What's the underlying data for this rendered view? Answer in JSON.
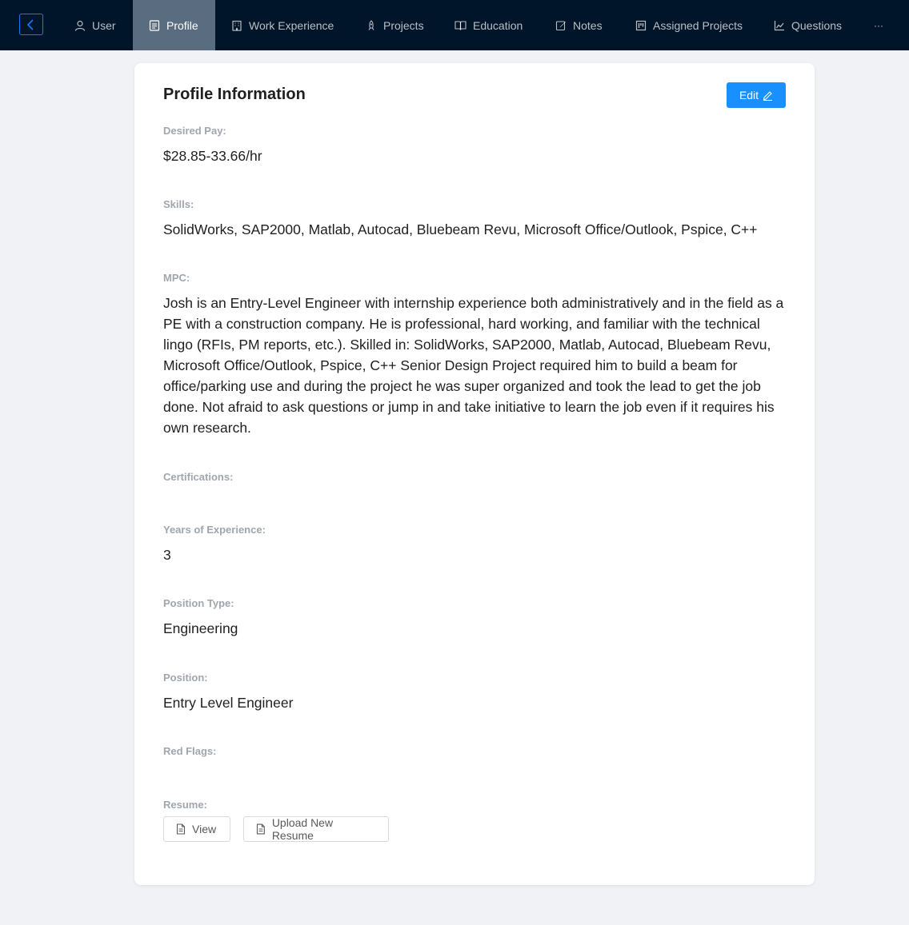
{
  "nav": {
    "back_icon": "chevron-left-icon",
    "items": [
      {
        "label": "User",
        "icon": "user-icon"
      },
      {
        "label": "Profile",
        "icon": "profile-icon",
        "active": true
      },
      {
        "label": "Work Experience",
        "icon": "building-icon"
      },
      {
        "label": "Projects",
        "icon": "rocket-icon"
      },
      {
        "label": "Education",
        "icon": "book-icon"
      },
      {
        "label": "Notes",
        "icon": "edit-icon"
      },
      {
        "label": "Assigned Projects",
        "icon": "project-icon"
      },
      {
        "label": "Questions",
        "icon": "chart-icon"
      }
    ],
    "more_label": "···"
  },
  "card": {
    "title": "Profile Information",
    "edit_label": "Edit"
  },
  "fields": {
    "desired_pay": {
      "label": "Desired Pay:",
      "value": "$28.85-33.66/hr"
    },
    "skills": {
      "label": "Skills:",
      "value": "SolidWorks, SAP2000, Matlab, Autocad, Bluebeam Revu, Microsoft Office/Outlook, Pspice, C++"
    },
    "mpc": {
      "label": "MPC:",
      "value": "Josh is an Entry-Level Engineer with internship experience both administratively and in the field as a PE with a construction company. He is professional, hard working, and familiar with the technical lingo (RFIs, PM reports, etc.). Skilled in: SolidWorks, SAP2000, Matlab, Autocad, Bluebeam Revu, Microsoft Office/Outlook, Pspice, C++ Senior Design Project required him to build a beam for office/parking use and during the project he was super organized and took the lead to get the job done. Not afraid to ask questions or jump in and take initiative to learn the job even if it requires his own research."
    },
    "certifications": {
      "label": "Certifications:",
      "value": ""
    },
    "years_experience": {
      "label": "Years of Experience:",
      "value": "3"
    },
    "position_type": {
      "label": "Position Type:",
      "value": "Engineering"
    },
    "position": {
      "label": "Position:",
      "value": "Entry Level Engineer"
    },
    "red_flags": {
      "label": "Red Flags:",
      "value": ""
    },
    "resume": {
      "label": "Resume:",
      "view_label": "View",
      "upload_label": "Upload New Resume"
    }
  },
  "colors": {
    "nav_bg": "#001529",
    "nav_active_bg": "#5a6d80",
    "primary": "#1890ff",
    "label": "#a0a6ae"
  }
}
